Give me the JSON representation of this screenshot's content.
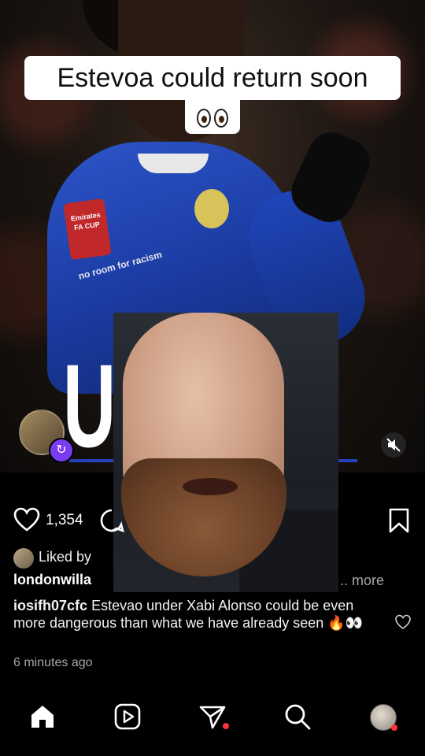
{
  "post": {
    "overlay_title": "Estevoa could return soon",
    "overlay_emoji": "eyes",
    "jersey_badge_text": "Emirates FA CUP",
    "sponsor_text": "no room for racism",
    "headline_visible": "U    TE"
  },
  "actions": {
    "like_count": "1,354",
    "liked_by": "Liked by",
    "caption_user": "londonwilla",
    "more": ".. more"
  },
  "comment": {
    "user": "iosifh07cfc",
    "text": "Estevao under Xabi Alonso could be even more dangerous than what we have already seen",
    "emojis": "🔥👀"
  },
  "time_ago": "6 minutes ago",
  "nav": {
    "items": [
      "home-icon",
      "reels-icon",
      "messages-icon",
      "search-icon",
      "profile-avatar"
    ]
  },
  "colors": {
    "accent_red": "#ff3040",
    "collab_purple": "#7a3cf0",
    "jersey_blue": "#1a3aa0"
  }
}
